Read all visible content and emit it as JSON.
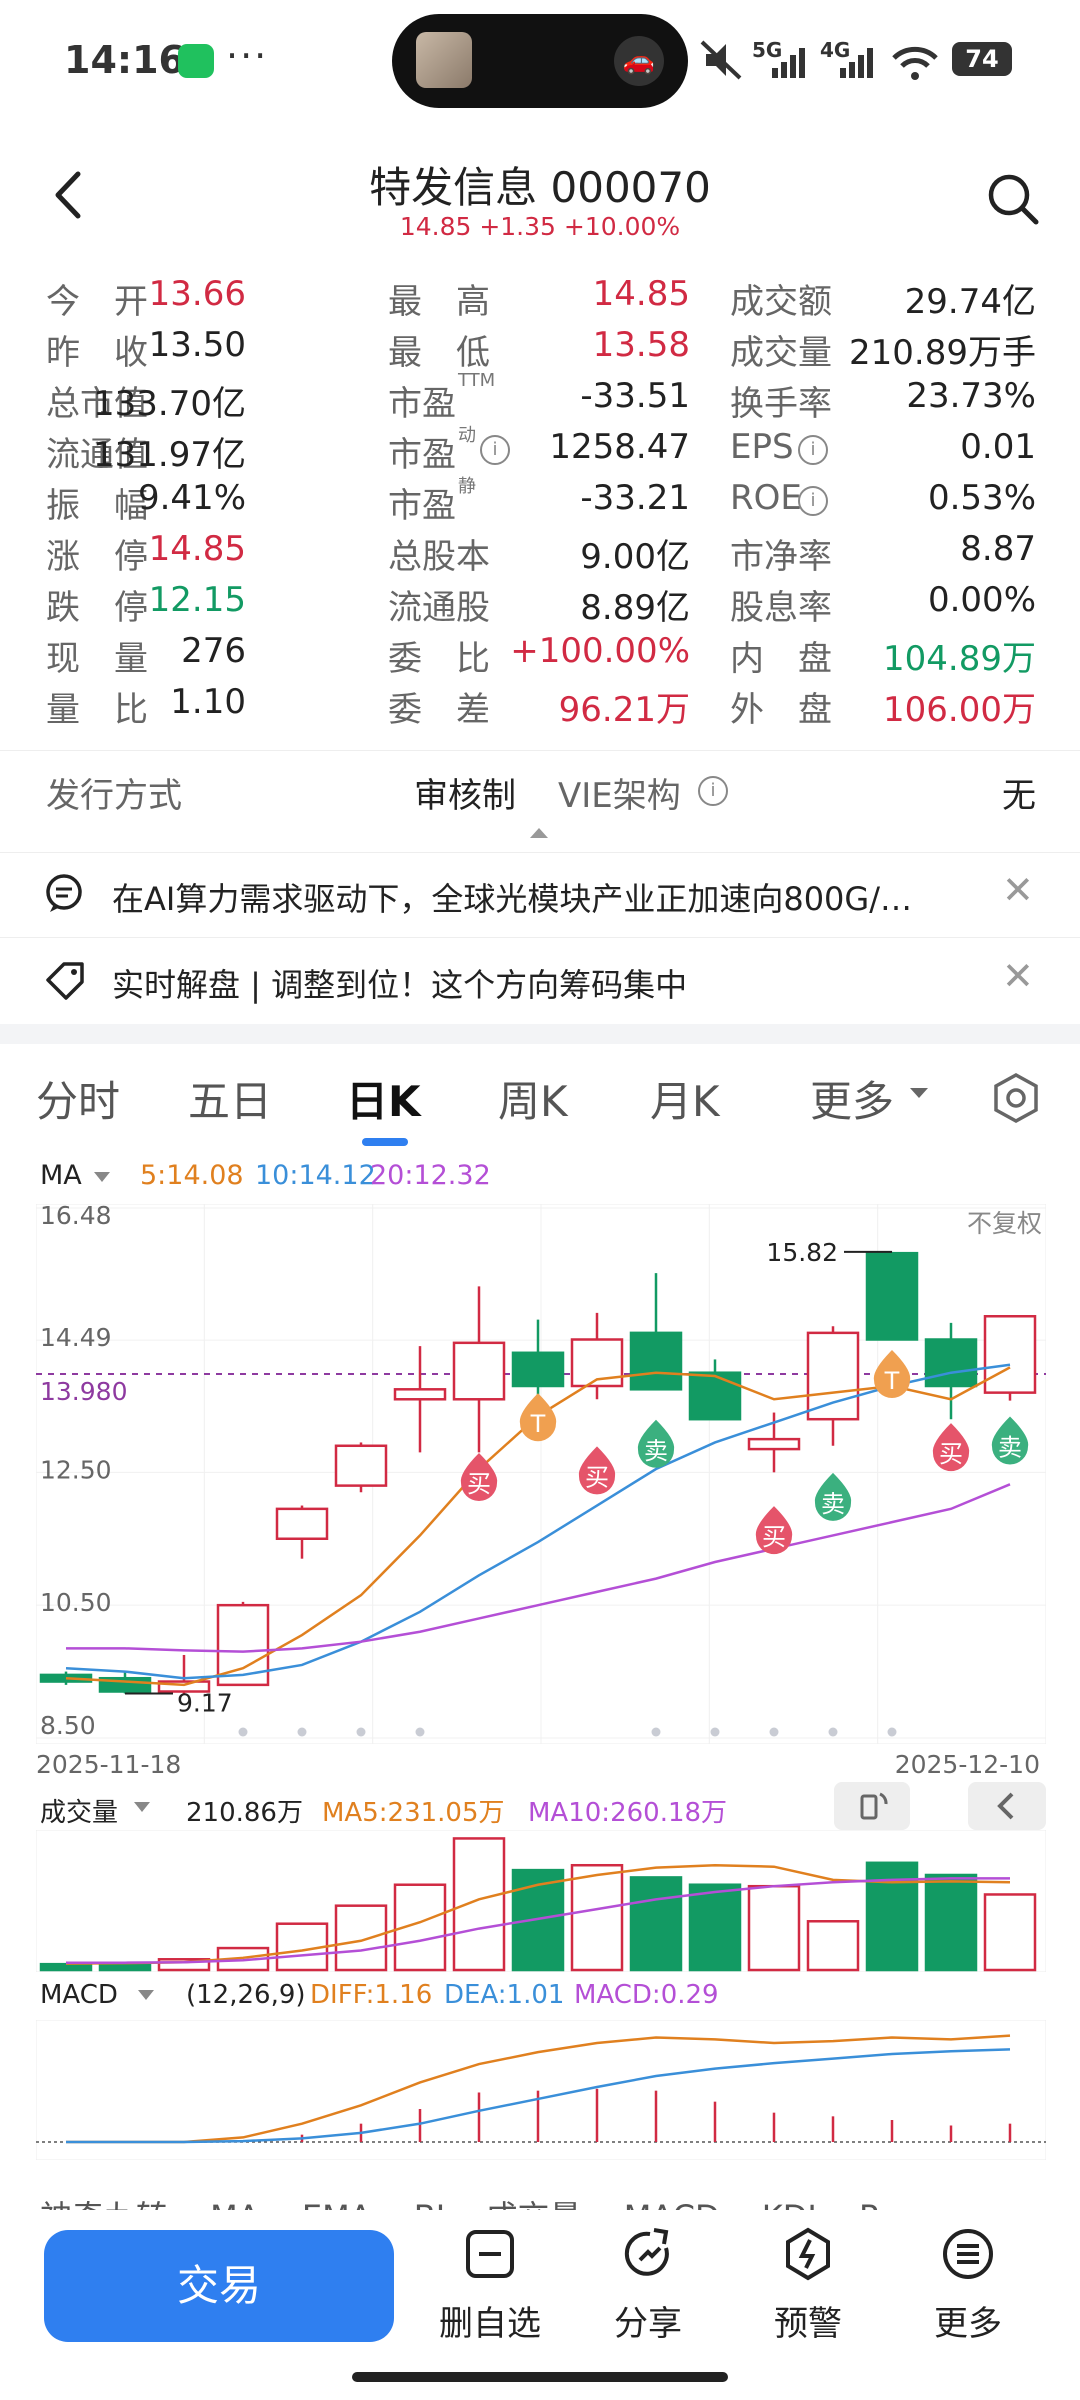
{
  "status_bar": {
    "time": "14:16",
    "dots": "···",
    "battery": "74",
    "signal1": "5G",
    "signal2": "4G"
  },
  "header": {
    "title": "特发信息 000070",
    "quote": "14.85 +1.35 +10.00%"
  },
  "stats": [
    [
      {
        "l": "今　开",
        "v": "13.66",
        "c": "red"
      },
      {
        "l": "最　高",
        "v": "14.85",
        "c": "red"
      },
      {
        "l": "成交额",
        "v": "29.74亿",
        "c": ""
      }
    ],
    [
      {
        "l": "昨　收",
        "v": "13.50",
        "c": ""
      },
      {
        "l": "最　低",
        "v": "13.58",
        "c": "red"
      },
      {
        "l": "成交量",
        "v": "210.89万手",
        "c": ""
      }
    ],
    [
      {
        "l": "总市值",
        "v": "133.70亿",
        "c": ""
      },
      {
        "l": "市盈",
        "s": "TTM",
        "v": "-33.51",
        "c": ""
      },
      {
        "l": "换手率",
        "v": "23.73%",
        "c": ""
      }
    ],
    [
      {
        "l": "流通值",
        "v": "131.97亿",
        "c": ""
      },
      {
        "l": "市盈",
        "s": "动",
        "i": true,
        "v": "1258.47",
        "c": ""
      },
      {
        "l": "EPS",
        "i": true,
        "v": "0.01",
        "c": ""
      }
    ],
    [
      {
        "l": "振　幅",
        "v": "9.41%",
        "c": ""
      },
      {
        "l": "市盈",
        "s": "静",
        "v": "-33.21",
        "c": ""
      },
      {
        "l": "ROE",
        "i": true,
        "v": "0.53%",
        "c": ""
      }
    ],
    [
      {
        "l": "涨　停",
        "v": "14.85",
        "c": "red"
      },
      {
        "l": "总股本",
        "v": "9.00亿",
        "c": ""
      },
      {
        "l": "市净率",
        "v": "8.87",
        "c": ""
      }
    ],
    [
      {
        "l": "跌　停",
        "v": "12.15",
        "c": "green"
      },
      {
        "l": "流通股",
        "v": "8.89亿",
        "c": ""
      },
      {
        "l": "股息率",
        "v": "0.00%",
        "c": ""
      }
    ],
    [
      {
        "l": "现　量",
        "v": "276",
        "c": ""
      },
      {
        "l": "委　比",
        "v": "+100.00%",
        "c": "red"
      },
      {
        "l": "内　盘",
        "v": "104.89万",
        "c": "green"
      }
    ],
    [
      {
        "l": "量　比",
        "v": "1.10",
        "c": ""
      },
      {
        "l": "委　差",
        "v": "96.21万",
        "c": "red"
      },
      {
        "l": "外　盘",
        "v": "106.00万",
        "c": "red"
      }
    ]
  ],
  "issue": {
    "label": "发行方式",
    "value1": "审核制",
    "label2": "VIE架构",
    "value2": "无"
  },
  "news": [
    "在AI算力需求驱动下，全球光模块产业正加速向800G/…",
    "实时解盘 | 调整到位！这个方向筹码集中"
  ],
  "tabs": [
    "分时",
    "五日",
    "日K",
    "周K",
    "月K",
    "更多"
  ],
  "active_tab": 2,
  "ma_legend": {
    "label": "MA",
    "ma5": "5:14.08",
    "ma10": "10:14.12",
    "ma20": "20:12.32"
  },
  "chart_labels": {
    "y_top": "16.48",
    "y2": "14.49",
    "y_ref": "13.980",
    "y3": "12.50",
    "y4": "10.50",
    "y_bottom": "8.50",
    "right_note": "不复权",
    "high_mark": "15.82",
    "low_mark": "9.17",
    "date_start": "2025-11-18",
    "date_end": "2025-12-10",
    "buy": "买",
    "sell": "卖",
    "t": "T"
  },
  "volume_legend": {
    "label": "成交量",
    "value": "210.86万",
    "ma5": "MA5:231.05万",
    "ma10": "MA10:260.18万"
  },
  "macd_legend": {
    "label": "MACD",
    "params": "(12,26,9)",
    "diff": "DIFF:1.16",
    "dea": "DEA:1.01",
    "macd": "MACD:0.29"
  },
  "indicator_tabs": "神奇九转　 MA　 EMA　 BL　成交量　 MACD　 KDJ　 R",
  "bottom_bar": {
    "trade": "交易",
    "remove": "删自选",
    "share": "分享",
    "alert": "预警",
    "more": "更多"
  },
  "colors": {
    "up": "#d12a43",
    "down": "#129a63",
    "accent": "#2f7ff0",
    "ma5": "#e0801f",
    "ma10": "#3a8fd9",
    "ma20": "#b44fd6"
  },
  "chart_data": [
    {
      "type": "candlestick",
      "title": "日K",
      "x": [
        "2025-11-18",
        "",
        "",
        "",
        "",
        "",
        "",
        "",
        "",
        "",
        "",
        "",
        "",
        "",
        "",
        "",
        "2025-12-10"
      ],
      "open": [
        9.45,
        9.4,
        9.2,
        9.3,
        11.5,
        12.3,
        13.6,
        13.6,
        14.3,
        13.8,
        14.6,
        14.0,
        12.85,
        13.3,
        15.8,
        14.5,
        13.7
      ],
      "close": [
        9.35,
        9.2,
        9.35,
        10.5,
        11.95,
        12.9,
        13.75,
        14.45,
        13.8,
        14.5,
        13.75,
        13.3,
        13.0,
        14.6,
        14.5,
        13.8,
        14.85
      ],
      "high": [
        9.5,
        9.5,
        9.75,
        10.55,
        12.0,
        12.95,
        14.4,
        15.3,
        14.8,
        14.9,
        15.5,
        14.2,
        13.4,
        14.7,
        15.82,
        14.75,
        14.85
      ],
      "low": [
        9.3,
        9.17,
        9.15,
        9.3,
        11.2,
        12.2,
        12.8,
        12.8,
        13.3,
        13.6,
        14.0,
        13.3,
        12.5,
        12.9,
        14.5,
        13.3,
        13.58
      ],
      "ma5": [
        9.4,
        9.35,
        9.3,
        9.55,
        10.05,
        10.65,
        11.55,
        12.55,
        13.35,
        13.9,
        14.0,
        13.95,
        13.6,
        13.7,
        13.8,
        13.6,
        14.08
      ],
      "ma10": [
        9.55,
        9.5,
        9.4,
        9.45,
        9.6,
        9.95,
        10.4,
        10.95,
        11.45,
        12.0,
        12.55,
        12.95,
        13.25,
        13.55,
        13.8,
        14.0,
        14.12
      ],
      "ma20": [
        9.85,
        9.85,
        9.82,
        9.8,
        9.85,
        9.95,
        10.1,
        10.3,
        10.5,
        10.7,
        10.9,
        11.15,
        11.35,
        11.55,
        11.75,
        11.95,
        12.32
      ],
      "ylim": [
        8.5,
        16.48
      ],
      "ref_line": 13.98,
      "signals": [
        {
          "i": 7,
          "k": "buy",
          "y": 12.4
        },
        {
          "i": 8,
          "k": "t",
          "y": 13.3
        },
        {
          "i": 9,
          "k": "buy",
          "y": 12.5
        },
        {
          "i": 10,
          "k": "sell",
          "y": 12.9
        },
        {
          "i": 12,
          "k": "buy",
          "y": 11.6
        },
        {
          "i": 13,
          "k": "sell",
          "y": 12.1
        },
        {
          "i": 14,
          "k": "t",
          "y": 13.95
        },
        {
          "i": 15,
          "k": "buy",
          "y": 12.85
        },
        {
          "i": 16,
          "k": "sell",
          "y": 12.95
        }
      ],
      "dots": [
        3,
        4,
        5,
        6,
        10,
        11,
        12,
        13,
        14
      ]
    },
    {
      "type": "bar",
      "title": "成交量",
      "values": [
        0.12,
        0.14,
        0.22,
        0.45,
        0.95,
        1.32,
        1.75,
        2.7,
        2.05,
        2.15,
        1.9,
        1.75,
        1.72,
        1.0,
        2.2,
        1.95,
        1.55
      ],
      "ma5": [
        0.13,
        0.14,
        0.16,
        0.25,
        0.4,
        0.6,
        0.98,
        1.45,
        1.75,
        1.95,
        2.1,
        2.15,
        2.12,
        1.85,
        1.8,
        1.82,
        1.8
      ],
      "ma10": [
        0.15,
        0.15,
        0.16,
        0.2,
        0.3,
        0.4,
        0.6,
        0.85,
        1.05,
        1.25,
        1.45,
        1.6,
        1.72,
        1.8,
        1.85,
        1.88,
        1.88
      ],
      "ylim": [
        0,
        2.75
      ]
    },
    {
      "type": "bar",
      "title": "MACD",
      "macd": [
        0.0,
        0.0,
        0.0,
        0.02,
        0.08,
        0.2,
        0.36,
        0.54,
        0.56,
        0.58,
        0.56,
        0.44,
        0.32,
        0.28,
        0.24,
        0.18,
        0.2
      ],
      "diff": [
        0.0,
        0.0,
        0.0,
        0.05,
        0.2,
        0.4,
        0.65,
        0.85,
        0.98,
        1.08,
        1.14,
        1.12,
        1.08,
        1.1,
        1.14,
        1.12,
        1.16
      ],
      "dea": [
        0.0,
        0.0,
        0.0,
        0.01,
        0.04,
        0.1,
        0.2,
        0.34,
        0.47,
        0.6,
        0.72,
        0.8,
        0.86,
        0.91,
        0.96,
        0.99,
        1.01
      ],
      "ylim": [
        0,
        1.2
      ]
    }
  ]
}
